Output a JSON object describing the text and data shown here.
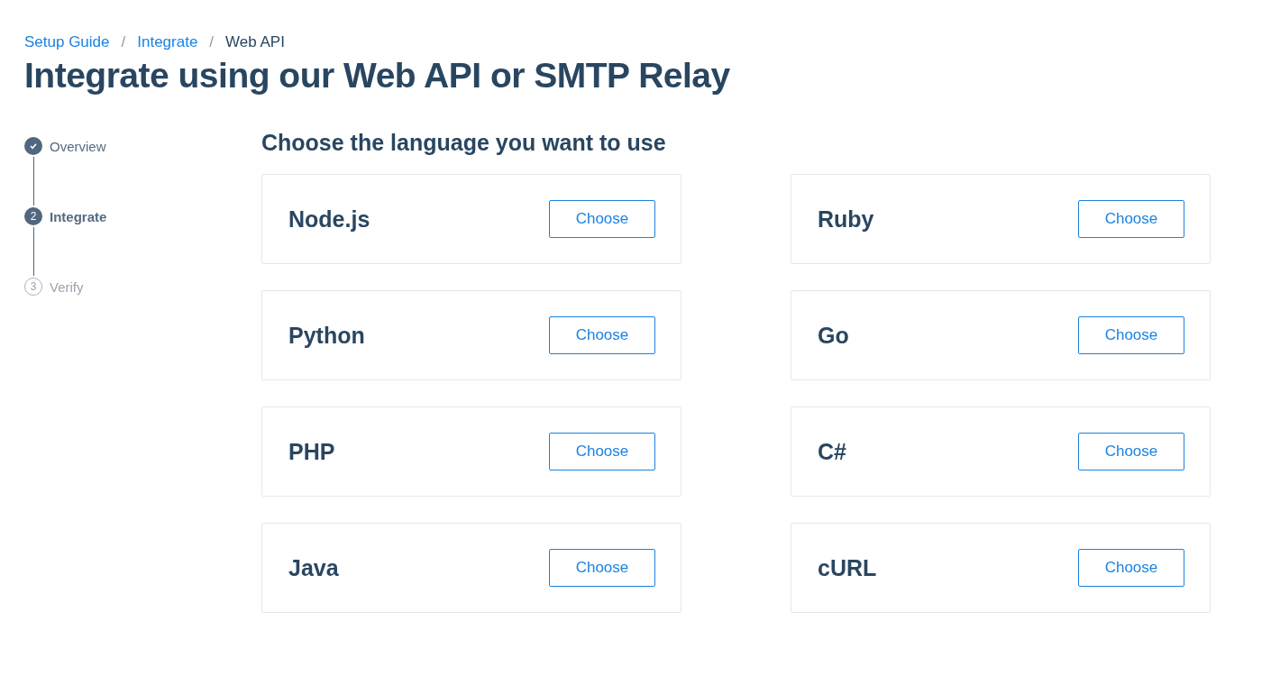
{
  "breadcrumb": [
    {
      "label": "Setup Guide",
      "kind": "link"
    },
    {
      "label": "/",
      "kind": "separator"
    },
    {
      "label": "Integrate",
      "kind": "link"
    },
    {
      "label": "/",
      "kind": "separator"
    },
    {
      "label": "Web API",
      "kind": "current"
    }
  ],
  "title": "Integrate using our Web API or SMTP Relay",
  "steps": [
    {
      "kind": "done",
      "label": "Overview"
    },
    {
      "kind": "current",
      "number": "2",
      "label": "Integrate"
    },
    {
      "kind": "upcoming",
      "number": "3",
      "label": "Verify"
    }
  ],
  "heading": "Choose the language you want to use",
  "languages": [
    {
      "name": "Node.js",
      "button": "Choose"
    },
    {
      "name": "Ruby",
      "button": "Choose"
    },
    {
      "name": "Python",
      "button": "Choose"
    },
    {
      "name": "Go",
      "button": "Choose"
    },
    {
      "name": "PHP",
      "button": "Choose"
    },
    {
      "name": "C#",
      "button": "Choose"
    },
    {
      "name": "Java",
      "button": "Choose"
    },
    {
      "name": "cURL",
      "button": "Choose"
    }
  ]
}
